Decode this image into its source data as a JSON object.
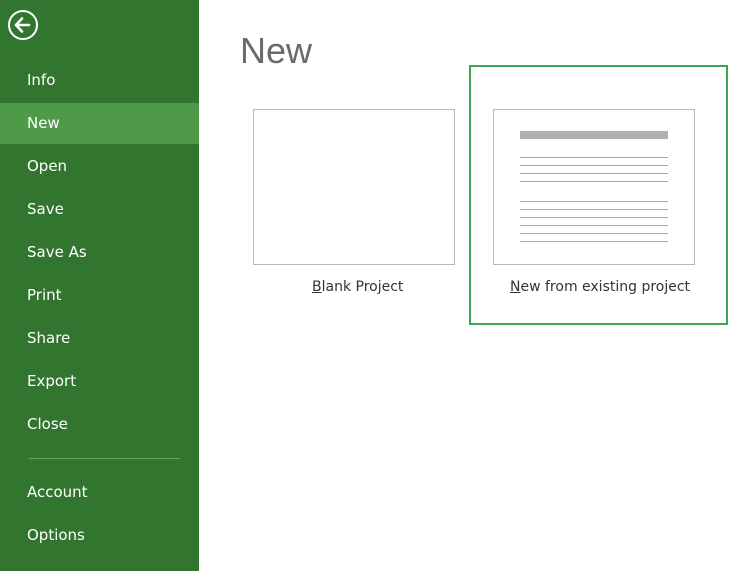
{
  "sidebar": {
    "back_icon": "back-arrow-icon",
    "items": [
      {
        "label": "Info"
      },
      {
        "label": "New",
        "selected": true
      },
      {
        "label": "Open"
      },
      {
        "label": "Save"
      },
      {
        "label": "Save As"
      },
      {
        "label": "Print"
      },
      {
        "label": "Share"
      },
      {
        "label": "Export"
      },
      {
        "label": "Close"
      },
      {
        "label": "Account"
      },
      {
        "label": "Options"
      }
    ],
    "colors": {
      "background": "#31752f",
      "selected": "#4e9a48",
      "text": "#ffffff"
    }
  },
  "main": {
    "title": "New",
    "templates": [
      {
        "label_first": "B",
        "label_rest": "lank Project"
      },
      {
        "label_first": "N",
        "label_rest": "ew from existing project",
        "highlighted": true
      }
    ],
    "highlight_color": "#3aa651"
  }
}
